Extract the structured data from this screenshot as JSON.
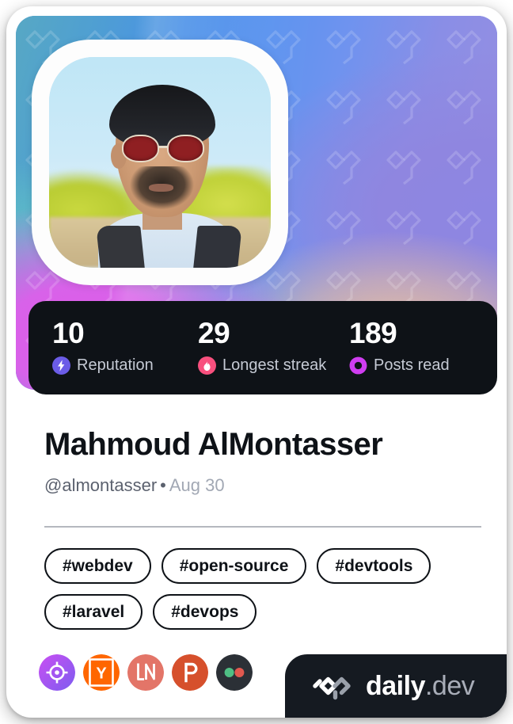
{
  "card": {
    "accent_dark": "#0e1217",
    "cover_gradient_from": "#57a8c4",
    "cover_gradient_mid": "#4a90e8",
    "cover_gradient_to": "#9c8ede",
    "cover_accent_magenta": "#e05ae8"
  },
  "avatar": {
    "icon": "user-photo",
    "alt": "Portrait photo of a man wearing red sunglasses outdoors"
  },
  "stats": [
    {
      "value": "10",
      "label": "Reputation",
      "icon": "reputation-bolt-icon",
      "color": "#6b5ce7"
    },
    {
      "value": "29",
      "label": "Longest streak",
      "icon": "streak-flame-icon",
      "color": "#f8507e"
    },
    {
      "value": "189",
      "label": "Posts read",
      "icon": "posts-read-eye-icon",
      "color": "#cf3df0"
    }
  ],
  "profile": {
    "name": "Mahmoud AlMontasser",
    "handle": "@almontasser",
    "separator": "•",
    "date": "Aug 30"
  },
  "tags": [
    "#webdev",
    "#open-source",
    "#devtools",
    "#laravel",
    "#devops"
  ],
  "socials": [
    {
      "name": "reflect",
      "icon": "reflect-crosshair-icon",
      "color": "#b44df0"
    },
    {
      "name": "hacker-news",
      "icon": "y-combinator-icon",
      "color": "#ff6600"
    },
    {
      "name": "linkedin",
      "icon": "ln-icon",
      "color": "#e37568"
    },
    {
      "name": "product-hunt",
      "icon": "product-hunt-p-icon",
      "color": "#d6502c"
    },
    {
      "name": "flickr",
      "icon": "flickr-dots-icon",
      "color": "#2b3036"
    }
  ],
  "brand": {
    "logo_icon": "daily-dev-logo-icon",
    "name": "daily",
    "tld": ".dev"
  }
}
